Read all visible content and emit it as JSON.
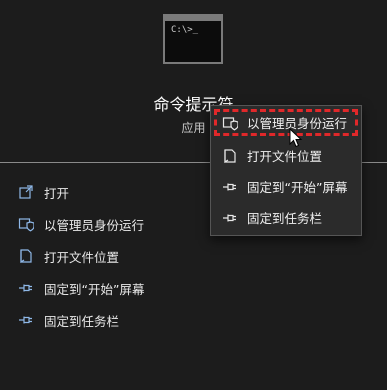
{
  "app": {
    "name": "命令提示符",
    "type": "应用",
    "icon": "command-prompt-icon",
    "prompt_glyph": "C:\\>_"
  },
  "actions": [
    {
      "label": "打开",
      "icon": "open-icon"
    },
    {
      "label": "以管理员身份运行",
      "icon": "shield-admin-icon"
    },
    {
      "label": "打开文件位置",
      "icon": "file-location-icon"
    },
    {
      "label": "固定到“开始”屏幕",
      "icon": "pin-icon"
    },
    {
      "label": "固定到任务栏",
      "icon": "pin-icon"
    }
  ],
  "context_menu": {
    "items": [
      {
        "label": "以管理员身份运行",
        "icon": "shield-admin-icon"
      },
      {
        "label": "打开文件位置",
        "icon": "file-location-icon"
      },
      {
        "label": "固定到“开始”屏幕",
        "icon": "pin-icon"
      },
      {
        "label": "固定到任务栏",
        "icon": "pin-icon"
      }
    ],
    "highlighted_index": 0
  },
  "colors": {
    "background": "#1c1c1c",
    "menu_background": "#2b2b2b",
    "highlight": "#e0282a"
  }
}
